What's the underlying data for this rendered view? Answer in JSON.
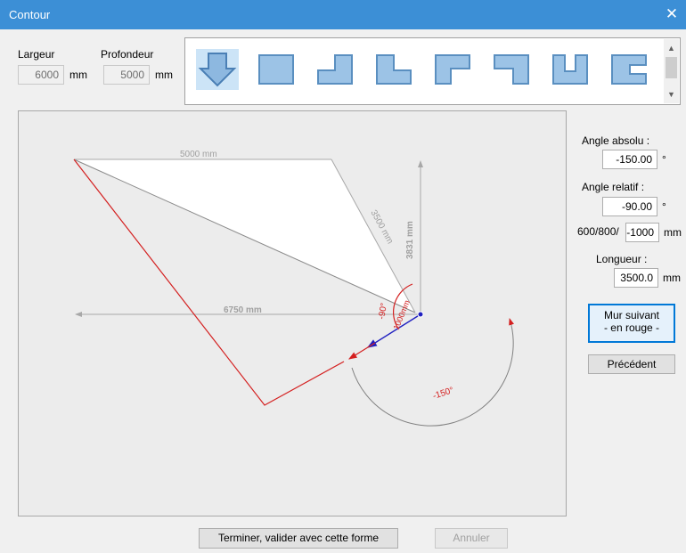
{
  "window": {
    "title": "Contour",
    "close_glyph": "✕"
  },
  "fields": {
    "width_label": "Largeur",
    "width_value": "6000",
    "width_unit": "mm",
    "depth_label": "Profondeur",
    "depth_value": "5000",
    "depth_unit": "mm"
  },
  "shapes": [
    {
      "name": "arrow-down-shape",
      "selected": true
    },
    {
      "name": "rectangle-shape"
    },
    {
      "name": "l-shape-left-notch"
    },
    {
      "name": "l-shape-right-step"
    },
    {
      "name": "l-shape-top-left"
    },
    {
      "name": "l-shape-top-right"
    },
    {
      "name": "u-shape"
    },
    {
      "name": "c-shape"
    }
  ],
  "right_panel": {
    "abs_angle_label": "Angle absolu :",
    "abs_angle_value": "-150.00",
    "abs_angle_unit": "°",
    "rel_angle_label": "Angle relatif :",
    "rel_angle_value": "-90.00",
    "rel_angle_unit": "°",
    "preset_label": "600/800/",
    "preset_value": "-1000",
    "preset_unit": "mm",
    "length_label": "Longueur :",
    "length_value": "3500.0",
    "length_unit": "mm",
    "next_wall_line1": "Mur suivant",
    "next_wall_line2": "- en rouge -",
    "previous_label": "Précédent"
  },
  "canvas": {
    "dim_top": "5000 mm",
    "dim_diag": "3500 mm",
    "dim_vert": "3831 mm",
    "dim_horiz": "6750 mm",
    "angle_rel": "-90°",
    "dim_small": "1000mm",
    "angle_abs": "-150°",
    "colors": {
      "wall_red": "#d42020",
      "dim_gray": "#a8a8a8",
      "current_blue": "#2020c0"
    }
  },
  "bottom": {
    "finish_label": "Terminer, valider avec cette forme",
    "cancel_label": "Annuler"
  }
}
